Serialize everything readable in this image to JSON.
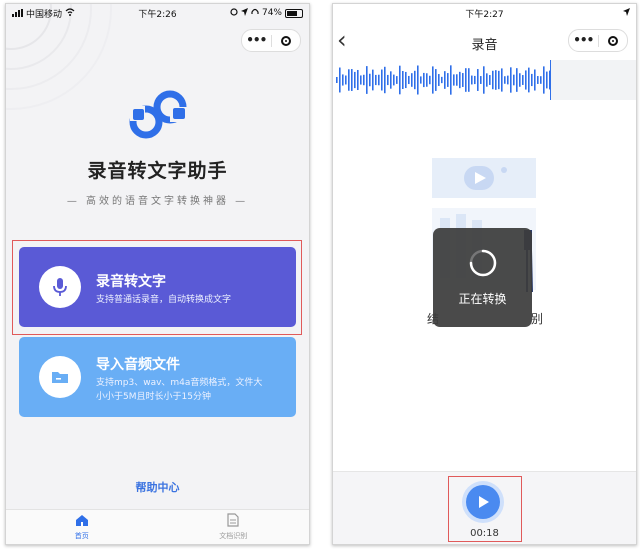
{
  "colors": {
    "primary": "#2f6fe8",
    "card1": "#5a5ad6",
    "card2": "#69aef5",
    "highlight": "#e05a5a"
  },
  "left": {
    "status": {
      "carrier": "中国移动",
      "time": "下午2:26",
      "battery": "74%"
    },
    "capsule": {
      "more": "•••"
    },
    "app_title": "录音转文字助手",
    "subtitle": "— 高效的语音文字转换神器 —",
    "cards": [
      {
        "title": "录音转文字",
        "desc": "支持普通话录音，自动转换成文字",
        "icon": "microphone-icon"
      },
      {
        "title": "导入音频文件",
        "desc": "支持mp3、wav、m4a音频格式，文件大小小于5M且时长小于15分钟",
        "icon": "folder-icon"
      }
    ],
    "help": "帮助中心",
    "tabs": [
      {
        "label": "首页",
        "icon": "home-icon"
      },
      {
        "label": "文档识别",
        "icon": "document-icon"
      }
    ]
  },
  "right": {
    "status": {
      "time": "下午2:27"
    },
    "capsule": {
      "more": "•••"
    },
    "nav_title": "录音",
    "loading_text": "正在转换",
    "behind_left": "结",
    "behind_right": "别",
    "playback_time": "00:18"
  }
}
